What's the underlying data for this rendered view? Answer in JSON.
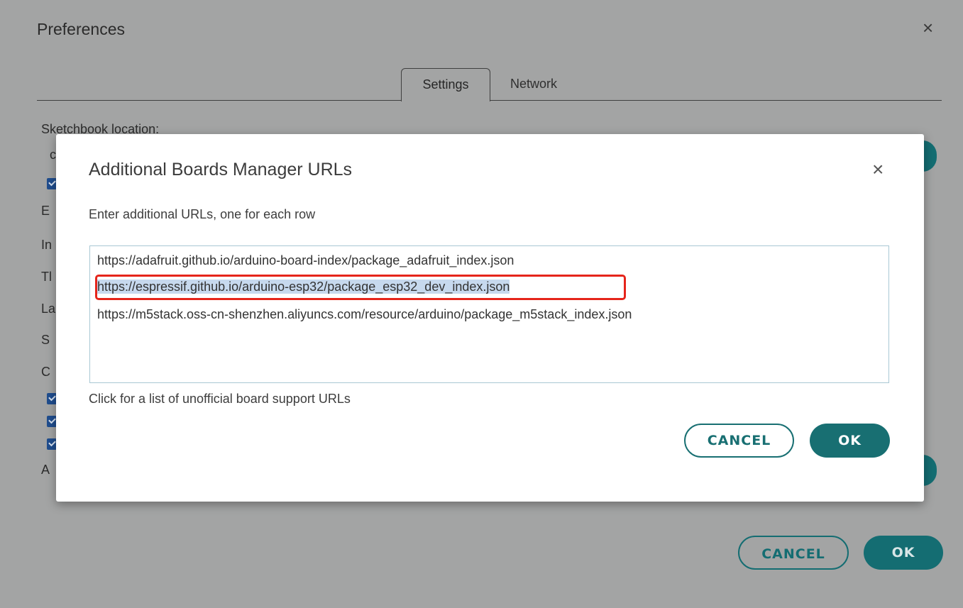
{
  "preferences": {
    "title": "Preferences",
    "close_icon": "×",
    "tabs": [
      {
        "label": "Settings",
        "active": true
      },
      {
        "label": "Network",
        "active": false
      }
    ],
    "sketchbook_label": "Sketchbook location:",
    "partial_row_letters": [
      "c",
      "E",
      "In",
      "Tl",
      "La",
      "S",
      "C",
      "A"
    ],
    "cancel_label": "CANCEL",
    "ok_label": "OK",
    "accent_color": "#146d72"
  },
  "modal": {
    "title": "Additional Boards Manager URLs",
    "close_icon": "×",
    "description": "Enter additional URLs, one for each row",
    "urls": [
      "https://adafruit.github.io/arduino-board-index/package_adafruit_index.json",
      "https://espressif.github.io/arduino-esp32/package_esp32_dev_index.json",
      "https://m5stack.oss-cn-shenzhen.aliyuncs.com/resource/arduino/package_m5stack_index.json"
    ],
    "selected_url_index": 1,
    "highlight_color": "#e5251b",
    "link_text": "Click for a list of unofficial board support URLs",
    "cancel_label": "CANCEL",
    "ok_label": "OK"
  }
}
